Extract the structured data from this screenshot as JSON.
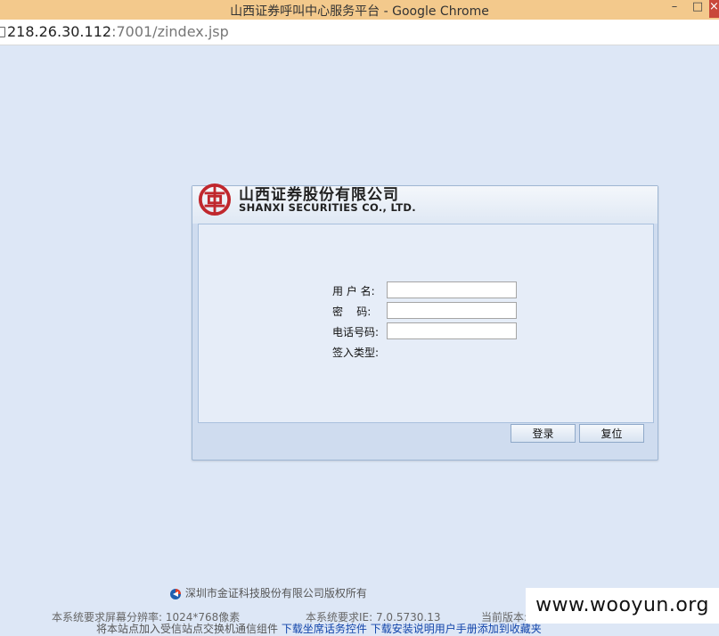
{
  "window": {
    "title": "山西证券呼叫中心服务平台 - Google Chrome",
    "controls": {
      "minimize": "–",
      "maximize": "□",
      "close": "×"
    }
  },
  "address_bar": {
    "host": "218.26.30.112",
    "path": ":7001/zindex.jsp"
  },
  "brand": {
    "cn_name": "山西证券股份有限公司",
    "en_name": "SHANXI SECURITIES CO., LTD.",
    "logo_color": "#c0272d"
  },
  "login_form": {
    "username_label": "用 户 名:",
    "username_value": "",
    "password_label": "密    码:",
    "password_value": "",
    "phone_label": "电话号码:",
    "phone_value": "",
    "login_type_label": "签入类型:",
    "login_button": "登录",
    "reset_button": "复位"
  },
  "footer": {
    "copyright": "深圳市金证科技股份有限公司版权所有",
    "resolution_req": "本系统要求屏幕分辨率: 1024*768像素",
    "ie_req": "本系统要求IE: 7.0.5730.13",
    "current_version": "当前版本:",
    "note_prefix": "将本站点加入受信站点交换机通信组件",
    "link_controls": "下载坐席话务控件",
    "link_manual": "下载安装说明用户手册添加到收藏夹"
  },
  "watermark": "www.wooyun.org"
}
